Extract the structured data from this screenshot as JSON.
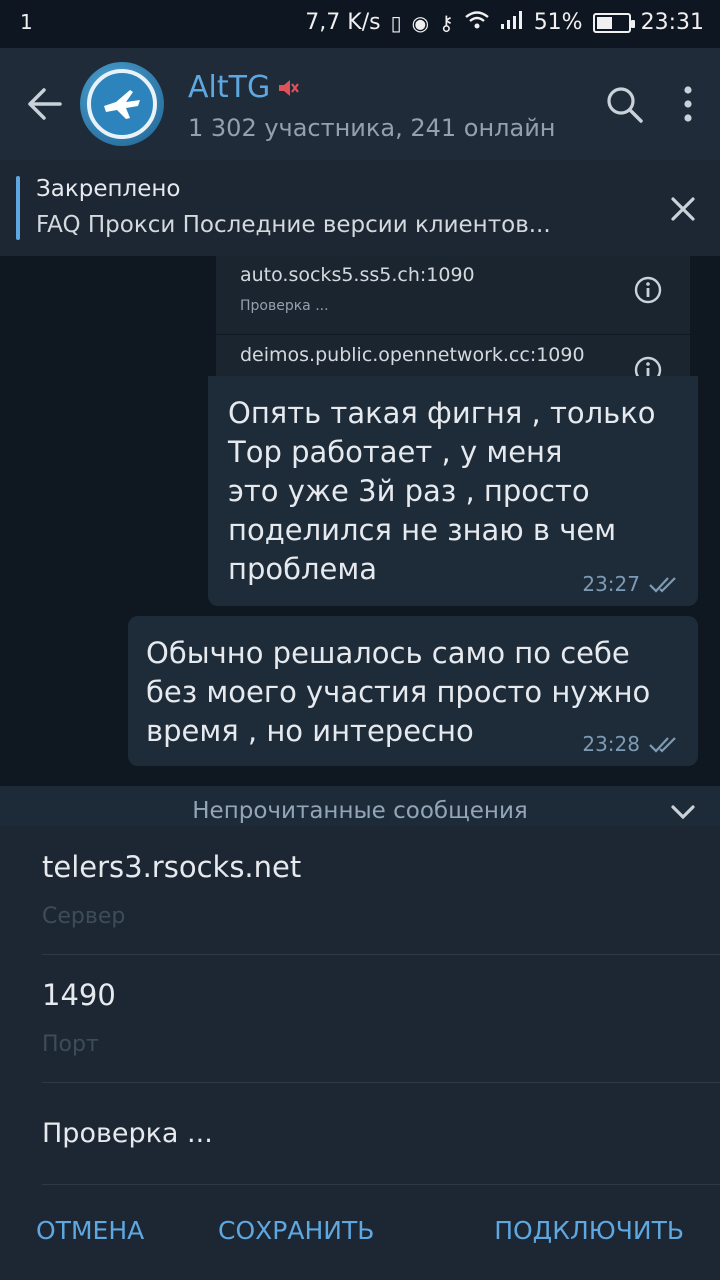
{
  "status_bar": {
    "left": "1",
    "speed": "7,7 K/s",
    "battery_percent": "51%",
    "battery_level": 0.51,
    "time": "23:31"
  },
  "header": {
    "title": "AltTG",
    "subtitle": "1 302 участника, 241 онлайн"
  },
  "pinned": {
    "label": "Закреплено",
    "text": "FAQ  Прокси  Последние версии клиентов..."
  },
  "proxies": [
    {
      "host": "auto.socks5.ss5.ch:1090",
      "status": "Проверка ..."
    },
    {
      "host": "deimos.public.opennetwork.cc:1090",
      "status": ""
    }
  ],
  "messages": [
    {
      "lines": [
        "Опять такая фигня , только",
        "Тор работает , у меня",
        "это уже 3й раз , просто",
        "поделился не знаю в чем",
        "проблема"
      ],
      "time": "23:27"
    },
    {
      "lines": [
        "Обычно решалось само по себе",
        "без моего участия просто нужно",
        "время , но интересно"
      ],
      "time": "23:28"
    }
  ],
  "unread_label": "Непрочитанные сообщения",
  "dialog": {
    "server_value": "telers3.rsocks.net",
    "server_hint": "Сервер",
    "port_value": "1490",
    "port_hint": "Порт",
    "checking": "Проверка ...",
    "cancel": "ОТМЕНА",
    "save": "СОХРАНИТЬ",
    "connect": "ПОДКЛЮЧИТЬ"
  },
  "colors": {
    "accent": "#5fa7e0",
    "muted_icon": "#e0525a"
  }
}
